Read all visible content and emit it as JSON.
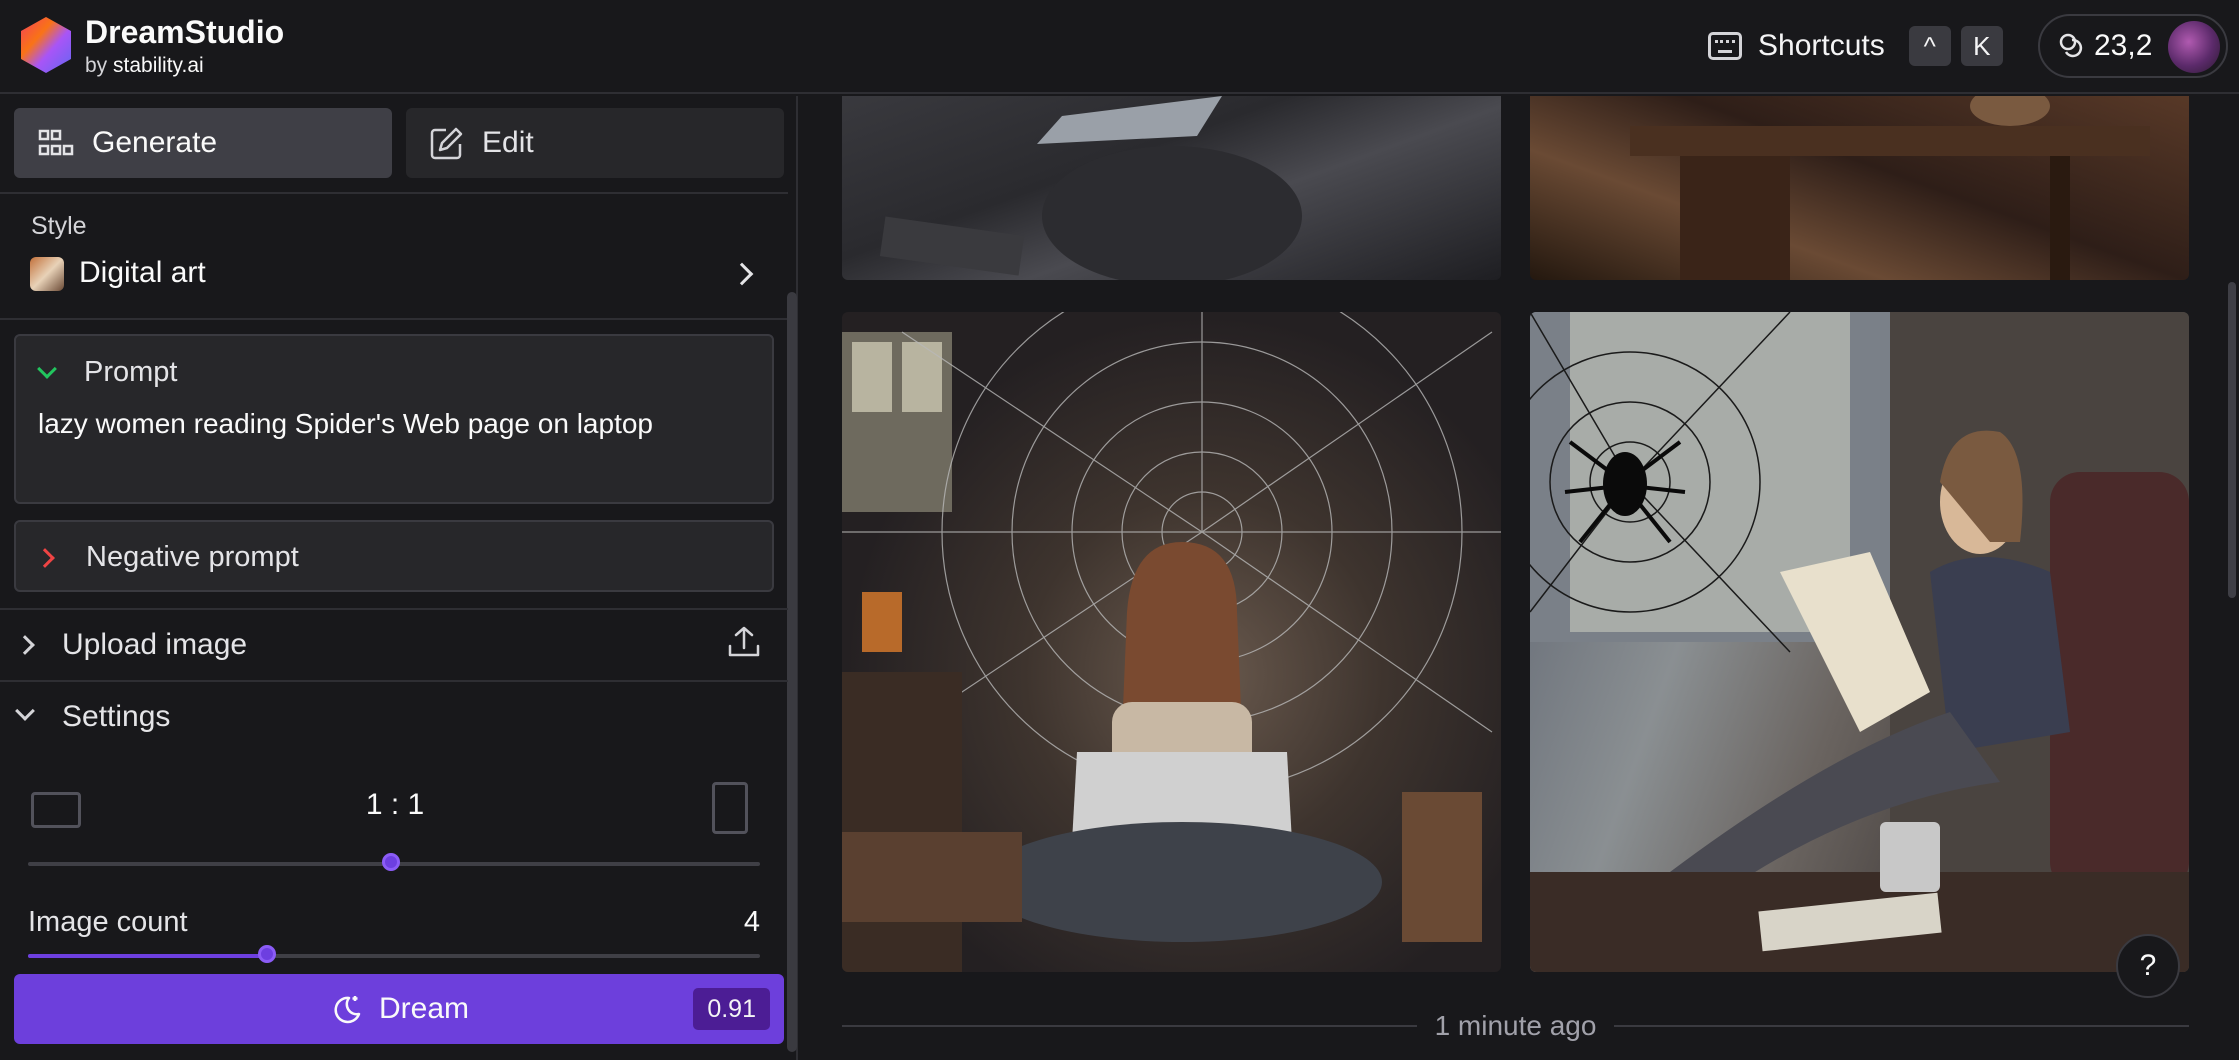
{
  "app": {
    "name": "DreamStudio",
    "by_prefix": "by",
    "by_brand": "stability.ai"
  },
  "header": {
    "shortcuts_label": "Shortcuts",
    "shortcut_keys": [
      "^",
      "K"
    ],
    "credits": "23,2"
  },
  "tabs": {
    "generate": "Generate",
    "edit": "Edit"
  },
  "style": {
    "label": "Style",
    "value": "Digital art"
  },
  "prompt": {
    "label": "Prompt",
    "text": "lazy women reading Spider's Web page on laptop"
  },
  "negative_prompt": {
    "label": "Negative prompt"
  },
  "upload_image": {
    "label": "Upload image"
  },
  "settings": {
    "label": "Settings",
    "aspect_ratio": "1 : 1",
    "aspect_slider_fraction": 0.5,
    "image_count_label": "Image count",
    "image_count": "4",
    "image_count_fraction": 0.33
  },
  "dream": {
    "label": "Dream",
    "cost": "0.91"
  },
  "gallery": {
    "timestamp": "1 minute ago",
    "help": "?"
  },
  "colors": {
    "accent": "#6d3fdc",
    "background": "#18181b"
  }
}
